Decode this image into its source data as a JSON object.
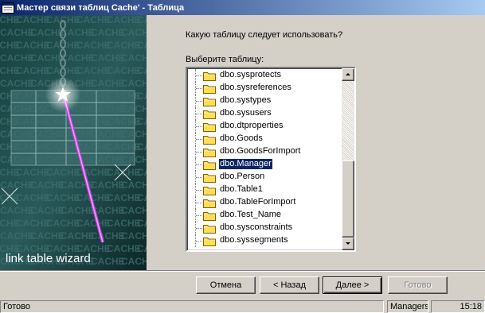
{
  "window": {
    "title": "Мастер связи таблиц Cache' - Таблица"
  },
  "art": {
    "caption": "link table wizard",
    "watermark_word": "CACHE"
  },
  "main": {
    "question": "Какую таблицу следует использовать?",
    "list_label": "Выберите таблицу:",
    "tables": [
      "dbo.sysprotects",
      "dbo.sysreferences",
      "dbo.systypes",
      "dbo.sysusers",
      "dbo.dtproperties",
      "dbo.Goods",
      "dbo.GoodsForImport",
      "dbo.Manager",
      "dbo.Person",
      "dbo.Table1",
      "dbo.TableForImport",
      "dbo.Test_Name",
      "dbo.sysconstraints",
      "dbo.syssegments"
    ],
    "selected_table": "dbo.Manager"
  },
  "buttons": {
    "cancel": "Отмена",
    "back": "< Назад",
    "next": "Далее >",
    "finish": "Готово"
  },
  "statusbar": {
    "status": "Готово",
    "database": "Managers",
    "time": "15:18"
  },
  "colors": {
    "titlebar_start": "#0a246a",
    "titlebar_end": "#a6caf0",
    "selection": "#0a246a",
    "face": "#d4d0c8",
    "folder": "#ffdd55"
  }
}
